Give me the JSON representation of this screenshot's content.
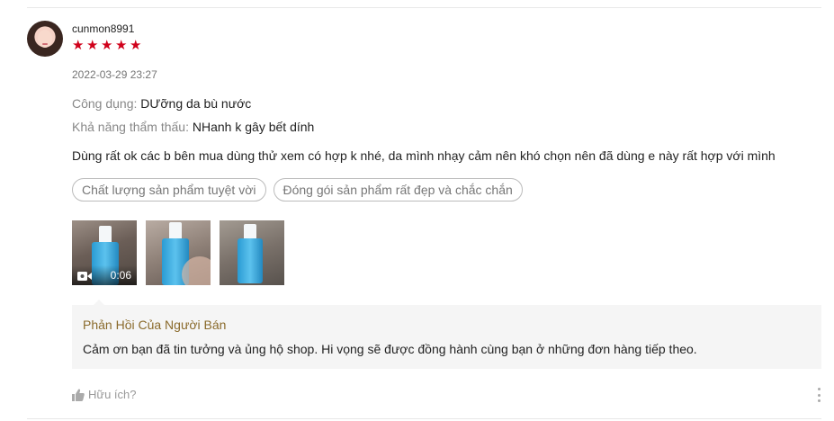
{
  "review": {
    "username": "cunmon8991",
    "rating": 5,
    "stars": [
      "★",
      "★",
      "★",
      "★",
      "★"
    ],
    "timestamp": "2022-03-29 23:27",
    "attributes": [
      {
        "key": "Công dụng:",
        "value": "DƯỡng da bù nước"
      },
      {
        "key": "Khả năng thẩm thấu:",
        "value": "NHanh k gây bết dính"
      }
    ],
    "comment": "Dùng rất ok các b bên mua dùng thử xem có hợp k nhé, da mình nhạy cảm nên khó chọn nên đã dùng e này rất hợp với mình",
    "tags": [
      "Chất lượng sản phẩm tuyệt vời",
      "Đóng gói sản phẩm rất đẹp và chắc chắn"
    ],
    "media": {
      "video_duration": "0:06"
    }
  },
  "seller_reply": {
    "title": "Phản Hồi Của Người Bán",
    "text": "Cảm ơn bạn đã tin tưởng và ủng hộ shop. Hi vọng sẽ được đồng hành cùng bạn ở những đơn hàng tiếp theo."
  },
  "footer": {
    "helpful_label": "Hữu ích?"
  },
  "colors": {
    "star": "#d0011b",
    "reply_title": "#8a6a2b",
    "reply_bg": "#f5f5f5",
    "tag_border": "#bbbbbb"
  },
  "icons": [
    "avatar",
    "star-icon",
    "video-camera-icon",
    "thumbs-up-icon",
    "more-vertical-icon"
  ]
}
